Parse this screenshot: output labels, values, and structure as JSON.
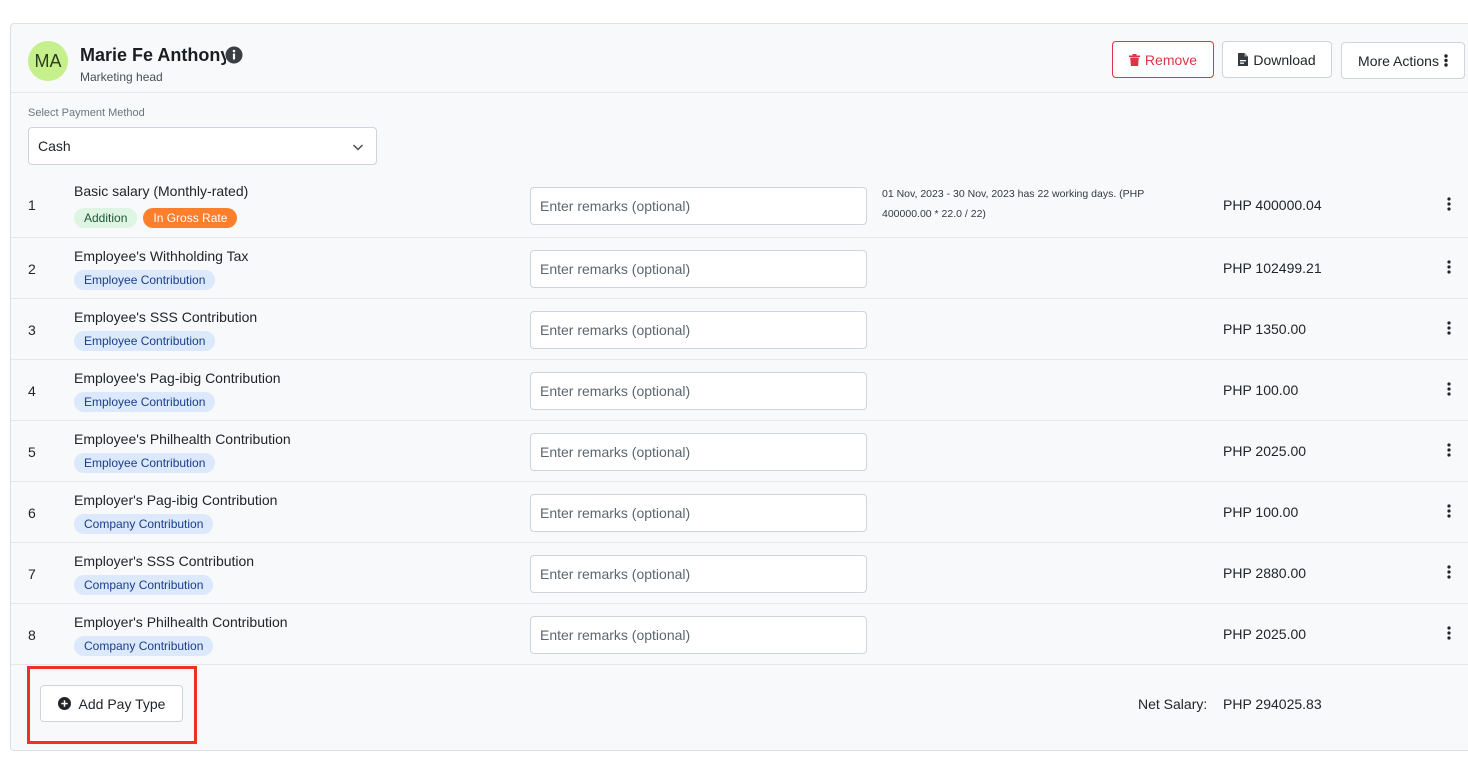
{
  "employee": {
    "initials": "MA",
    "name": "Marie Fe Anthony",
    "role": "Marketing head"
  },
  "actions": {
    "remove_label": "Remove",
    "download_label": "Download",
    "more_label": "More Actions"
  },
  "payment_method": {
    "label": "Select Payment Method",
    "selected": "Cash"
  },
  "remarks_placeholder": "Enter remarks (optional)",
  "rows": [
    {
      "num": "1",
      "title": "Basic salary (Monthly-rated)",
      "badges": [
        "Addition",
        "In Gross Rate"
      ],
      "note": "01 Nov, 2023 - 30 Nov, 2023 has 22 working days. (PHP 400000.00 * 22.0 / 22)",
      "amount": "PHP 400000.04"
    },
    {
      "num": "2",
      "title": "Employee's Withholding Tax",
      "badges": [
        "Employee Contribution"
      ],
      "note": "",
      "amount": "PHP 102499.21"
    },
    {
      "num": "3",
      "title": "Employee's SSS Contribution",
      "badges": [
        "Employee Contribution"
      ],
      "note": "",
      "amount": "PHP 1350.00"
    },
    {
      "num": "4",
      "title": "Employee's Pag-ibig Contribution",
      "badges": [
        "Employee Contribution"
      ],
      "note": "",
      "amount": "PHP 100.00"
    },
    {
      "num": "5",
      "title": "Employee's Philhealth Contribution",
      "badges": [
        "Employee Contribution"
      ],
      "note": "",
      "amount": "PHP 2025.00"
    },
    {
      "num": "6",
      "title": "Employer's Pag-ibig Contribution",
      "badges": [
        "Company Contribution"
      ],
      "note": "",
      "amount": "PHP 100.00"
    },
    {
      "num": "7",
      "title": "Employer's SSS Contribution",
      "badges": [
        "Company Contribution"
      ],
      "note": "",
      "amount": "PHP 2880.00"
    },
    {
      "num": "8",
      "title": "Employer's Philhealth Contribution",
      "badges": [
        "Company Contribution"
      ],
      "note": "",
      "amount": "PHP 2025.00"
    }
  ],
  "footer": {
    "add_label": "Add Pay Type",
    "net_label": "Net Salary:",
    "net_value": "PHP 294025.83"
  },
  "colors": {
    "danger": "#dc3545",
    "avatar_bg": "#c5f08c",
    "gross_badge": "#fd7e2b",
    "highlight": "#ea3323"
  }
}
